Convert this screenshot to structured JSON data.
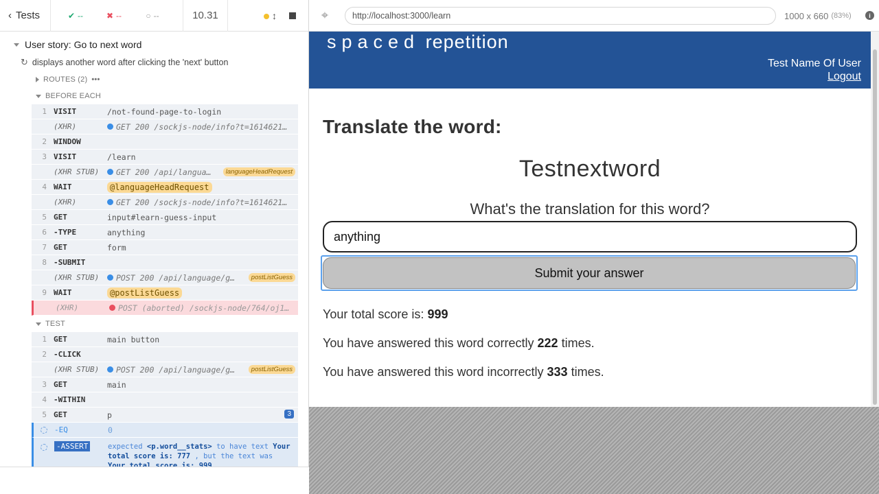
{
  "reporter": {
    "tests_label": "Tests",
    "passed": "--",
    "failed": "--",
    "pending": "--",
    "duration": "10.31",
    "suite_title": "User story: Go to next word",
    "test_title": "displays another word after clicking the 'next' button",
    "routes_label": "ROUTES (2)",
    "before_each_label": "BEFORE EACH",
    "test_label": "TEST",
    "before_each": [
      {
        "num": "1",
        "name": "VISIT",
        "msg": "/not-found-page-to-login"
      },
      {
        "num": "",
        "name": "(XHR)",
        "msg": "GET 200 /sockjs-node/info?t=1614621…"
      },
      {
        "num": "2",
        "name": "WINDOW",
        "msg": ""
      },
      {
        "num": "3",
        "name": "VISIT",
        "msg": "/learn"
      },
      {
        "num": "",
        "name": "(XHR STUB)",
        "msg": "GET 200 /api/langua…",
        "alias": "languageHeadRequest"
      },
      {
        "num": "4",
        "name": "WAIT",
        "msg": "@languageHeadRequest"
      },
      {
        "num": "",
        "name": "(XHR)",
        "msg": "GET 200 /sockjs-node/info?t=1614621…"
      },
      {
        "num": "5",
        "name": "GET",
        "msg": "input#learn-guess-input"
      },
      {
        "num": "6",
        "name": "-TYPE",
        "msg": "anything"
      },
      {
        "num": "7",
        "name": "GET",
        "msg": "form"
      },
      {
        "num": "8",
        "name": "-SUBMIT",
        "msg": ""
      },
      {
        "num": "",
        "name": "(XHR STUB)",
        "msg": "POST 200 /api/language/g…",
        "alias": "postListGuess"
      },
      {
        "num": "9",
        "name": "WAIT",
        "msg": "@postListGuess"
      },
      {
        "num": "",
        "name": "(XHR)",
        "msg": "POST (aborted) /sockjs-node/764/oj1…"
      }
    ],
    "test_cmds": [
      {
        "num": "1",
        "name": "GET",
        "msg": "main button"
      },
      {
        "num": "2",
        "name": "-CLICK",
        "msg": ""
      },
      {
        "num": "",
        "name": "(XHR STUB)",
        "msg": "POST 200 /api/language/g…",
        "alias": "postListGuess"
      },
      {
        "num": "3",
        "name": "GET",
        "msg": "main"
      },
      {
        "num": "4",
        "name": "-WITHIN",
        "msg": ""
      },
      {
        "num": "5",
        "name": "GET",
        "msg": "p",
        "badge": "3"
      },
      {
        "num": "",
        "name": "-EQ",
        "msg": "0"
      },
      {
        "num": "",
        "name": "-ASSERT",
        "msg_pre": "expected",
        "msg_sel": "<p.word__stats>",
        "msg_mid": "to have text",
        "msg_exp": "Your total score is: 777",
        "msg_mid2": ", but the text was",
        "msg_act": "Your total score is: 999"
      }
    ]
  },
  "aut": {
    "url": "http://localhost:3000/learn",
    "viewport": "1000 x 660",
    "scale": "(83%)",
    "site_title_a": "spaced",
    "site_title_b": "repetition",
    "user_name": "Test Name Of User",
    "logout": "Logout",
    "heading": "Translate the word:",
    "word": "Testnextword",
    "question": "What's the translation for this word?",
    "input_value": "anything",
    "submit_label": "Submit your answer",
    "score_text": "Your total score is:",
    "score_value": "999",
    "correct_pre": "You have answered this word correctly",
    "correct_value": "222",
    "correct_post": "times.",
    "incorrect_pre": "You have answered this word incorrectly",
    "incorrect_value": "333",
    "incorrect_post": "times."
  }
}
